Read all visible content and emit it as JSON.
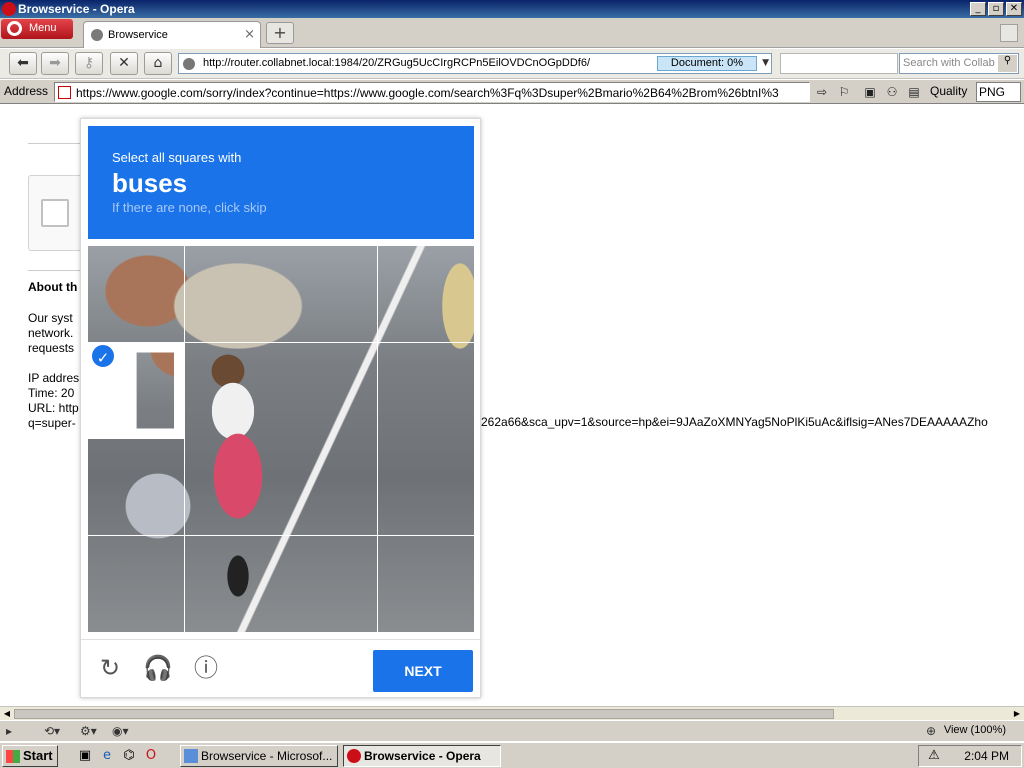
{
  "window": {
    "title": "Browservice - Opera",
    "controls": [
      "_",
      "▫",
      "✕"
    ]
  },
  "tabbar": {
    "menu_label": "Menu",
    "tabs": [
      {
        "label": "Browservice"
      }
    ],
    "new_tab_label": "+"
  },
  "navbar": {
    "url": "http://router.collabnet.local:1984/20/ZRGug5UcCIrgRCPn5EilOVDCnOGpDDf6/",
    "document_progress": "Document:   0%",
    "search_placeholder": "Search with Collab"
  },
  "addressbar": {
    "label": "Address",
    "url": "https://www.google.com/sorry/index?continue=https://www.google.com/search%3Fq%3Dsuper%2Bmario%2B64%2Brom%26btnI%3",
    "quality_label": "Quality",
    "quality_value": "PNG"
  },
  "page": {
    "about_heading": "About th",
    "body_lines": [
      "Our syst",
      "network.",
      "requests"
    ],
    "info_lines": [
      "IP addres",
      "Time: 20",
      "URL: http",
      "q=super-"
    ],
    "url_tail": "262a66&sca_upv=1&source=hp&ei=9JAaZoXMNYag5NoPlKi5uAc&iflsig=ANes7DEAAAAAZho"
  },
  "captcha": {
    "instruction": "Select all squares with",
    "target": "buses",
    "hint": "If there are none, click skip",
    "next_label": "NEXT",
    "selected_tile": {
      "row": 1,
      "col": 0
    }
  },
  "statusbar": {
    "zoom": "View (100%)"
  },
  "taskbar": {
    "start_label": "Start",
    "tasks": [
      {
        "label": "Browservice - Microsof..."
      },
      {
        "label": "Browservice - Opera"
      }
    ],
    "clock": "2:04 PM"
  }
}
